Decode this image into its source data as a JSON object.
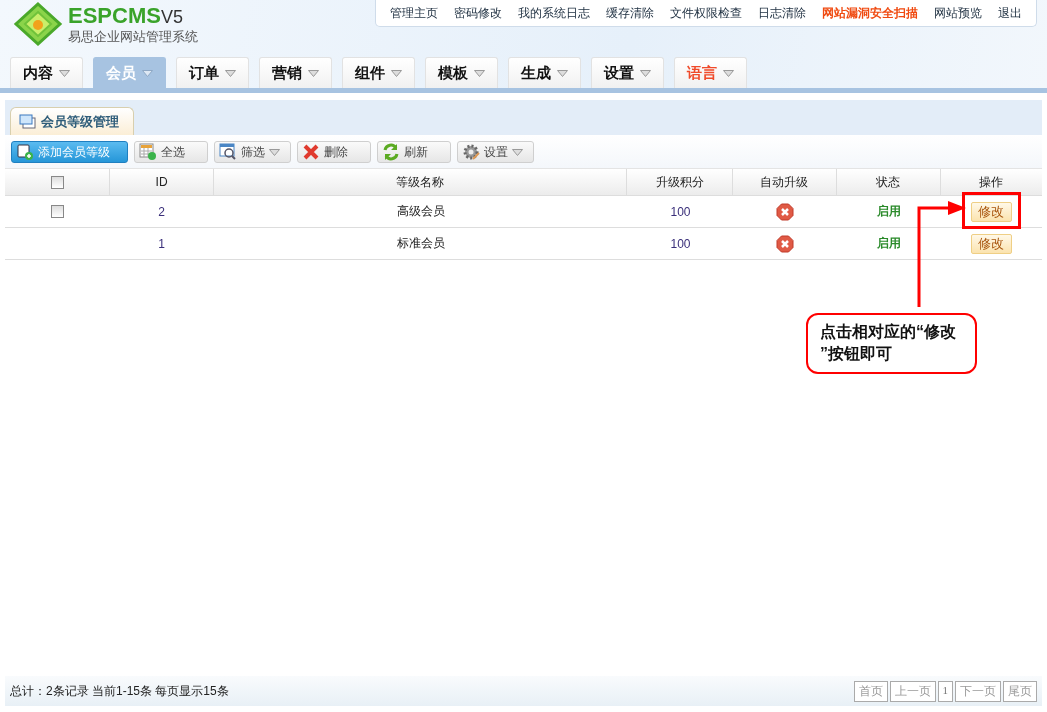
{
  "logo": {
    "brand": "ESPCMS",
    "version": "V5",
    "subtitle": "易思企业网站管理系统"
  },
  "top_links": [
    {
      "label": "管理主页",
      "highlight": false
    },
    {
      "label": "密码修改",
      "highlight": false
    },
    {
      "label": "我的系统日志",
      "highlight": false
    },
    {
      "label": "缓存清除",
      "highlight": false
    },
    {
      "label": "文件权限检查",
      "highlight": false
    },
    {
      "label": "日志清除",
      "highlight": false
    },
    {
      "label": "网站漏洞安全扫描",
      "highlight": true
    },
    {
      "label": "网站预览",
      "highlight": false
    },
    {
      "label": "退出",
      "highlight": false
    }
  ],
  "nav_tabs": [
    {
      "label": "内容",
      "selected": false,
      "highlight": false
    },
    {
      "label": "会员",
      "selected": true,
      "highlight": false
    },
    {
      "label": "订单",
      "selected": false,
      "highlight": false
    },
    {
      "label": "营销",
      "selected": false,
      "highlight": false
    },
    {
      "label": "组件",
      "selected": false,
      "highlight": false
    },
    {
      "label": "模板",
      "selected": false,
      "highlight": false
    },
    {
      "label": "生成",
      "selected": false,
      "highlight": false
    },
    {
      "label": "设置",
      "selected": false,
      "highlight": false
    },
    {
      "label": "语言",
      "selected": false,
      "highlight": true
    }
  ],
  "panel_tab": {
    "title": "会员等级管理"
  },
  "toolbar": [
    {
      "label": "添加会员等级",
      "kind": "primary",
      "dropdown": false
    },
    {
      "label": "全选",
      "kind": "normal",
      "dropdown": false
    },
    {
      "label": "筛选",
      "kind": "normal",
      "dropdown": true
    },
    {
      "label": "删除",
      "kind": "normal",
      "dropdown": false
    },
    {
      "label": "刷新",
      "kind": "normal",
      "dropdown": false
    },
    {
      "label": "设置",
      "kind": "normal",
      "dropdown": true
    }
  ],
  "table": {
    "header_checked": false,
    "columns": [
      "ID",
      "等级名称",
      "升级积分",
      "自动升级",
      "状态",
      "操作"
    ],
    "rows": [
      {
        "has_checkbox": true,
        "checked": false,
        "id": "2",
        "name": "高级会员",
        "points": "100",
        "auto_upgrade": false,
        "status": "启用",
        "action": "修改"
      },
      {
        "has_checkbox": false,
        "id": "1",
        "name": "标准会员",
        "points": "100",
        "auto_upgrade": false,
        "status": "启用",
        "action": "修改"
      }
    ]
  },
  "annotation": {
    "text": "点击相对应的“修改”按钮即可"
  },
  "footer": {
    "summary": "总计：2条记录 当前1-15条 每页显示15条",
    "pager": [
      {
        "label": "首页",
        "kind": "link"
      },
      {
        "label": "上一页",
        "kind": "link"
      },
      {
        "label": "1",
        "kind": "page"
      },
      {
        "label": "下一页",
        "kind": "link"
      },
      {
        "label": "尾页",
        "kind": "link"
      }
    ]
  }
}
